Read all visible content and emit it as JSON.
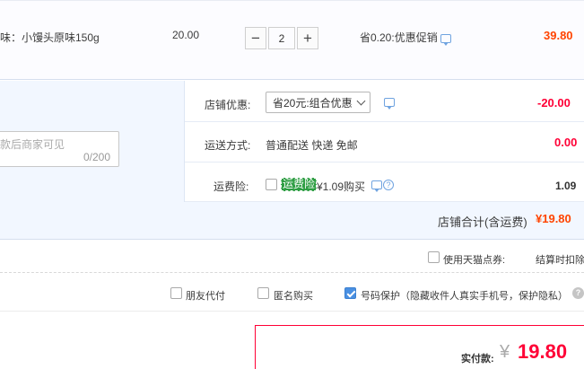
{
  "item": {
    "name": "味：小馒头原味150g",
    "price": "20.00",
    "quantity": "2",
    "minus_symbol": "−",
    "plus_symbol": "+",
    "promo": "省0.20:优惠促销",
    "subtotal": "39.80"
  },
  "shop": {
    "memo_placeholder": "款后商家可见",
    "memo_count": "0/200",
    "discount_label": "店铺优惠:",
    "discount_selected": "省20元:组合优惠",
    "discount_amount": "-20.00",
    "shipping_label": "运送方式:",
    "shipping_value": "普通配送 快递 免邮",
    "shipping_amount": "0.00",
    "insurance_label": "运费险:",
    "insurance_badge": "运费险",
    "insurance_text": "¥1.09购买",
    "insurance_amount": "1.09",
    "total_label": "店铺合计(含运费)",
    "total_value": "¥19.80"
  },
  "options": {
    "tmall_points": "使用天猫点券:",
    "settle_note": "结算时扣除",
    "friend_pay": "朋友代付",
    "anonymous": "匿名购买",
    "number_protect": "号码保护（隐藏收件人真实手机号，保护隐私）",
    "help_symbol": "?"
  },
  "payment": {
    "label": "实付款:",
    "currency": "¥",
    "amount": "19.80"
  },
  "colors": {
    "accent_red": "#ff0036",
    "price_orange": "#ff4400",
    "link_blue": "#6fa3e0",
    "panel_bg": "#f2f7ff",
    "insurance_green": "#2f9e44"
  }
}
